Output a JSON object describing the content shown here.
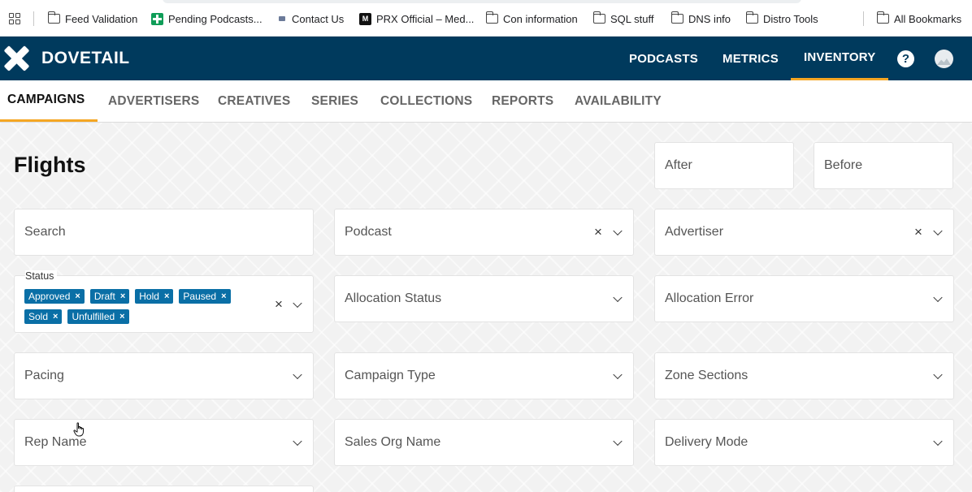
{
  "bookmarks": {
    "items": [
      {
        "label": "Feed Validation",
        "icon": "folder-icon"
      },
      {
        "label": "Pending Podcasts...",
        "icon": "sheet-icon"
      },
      {
        "label": "Contact Us",
        "icon": "contact-icon"
      },
      {
        "label": "PRX Official – Med...",
        "icon": "medium-icon",
        "badge": "M"
      },
      {
        "label": "Con information",
        "icon": "folder-icon"
      },
      {
        "label": "SQL stuff",
        "icon": "folder-icon"
      },
      {
        "label": "DNS info",
        "icon": "folder-icon"
      },
      {
        "label": "Distro Tools",
        "icon": "folder-icon"
      }
    ],
    "all_bookmarks": "All Bookmarks"
  },
  "navbar": {
    "brand": "DOVETAIL",
    "links": [
      "PODCASTS",
      "METRICS",
      "INVENTORY"
    ],
    "active": "INVENTORY",
    "help_glyph": "?",
    "accent_color": "#f5a623",
    "bg_color": "#003a5d"
  },
  "subnav": {
    "tabs": [
      "CAMPAIGNS",
      "ADVERTISERS",
      "CREATIVES",
      "SERIES",
      "COLLECTIONS",
      "REPORTS",
      "AVAILABILITY"
    ],
    "active": "CAMPAIGNS"
  },
  "page": {
    "title": "Flights",
    "after_placeholder": "After",
    "before_placeholder": "Before"
  },
  "filters": {
    "search": "Search",
    "podcast": "Podcast",
    "advertiser": "Advertiser",
    "status_label": "Status",
    "status_chips": [
      "Approved",
      "Draft",
      "Hold",
      "Paused",
      "Sold",
      "Unfulfilled"
    ],
    "allocation_status": "Allocation Status",
    "allocation_error": "Allocation Error",
    "pacing": "Pacing",
    "campaign_type": "Campaign Type",
    "zone_sections": "Zone Sections",
    "rep_name": "Rep Name",
    "sales_org_name": "Sales Org Name",
    "delivery_mode": "Delivery Mode",
    "clear_glyph": "×",
    "chip_color": "#0a6fa6"
  }
}
